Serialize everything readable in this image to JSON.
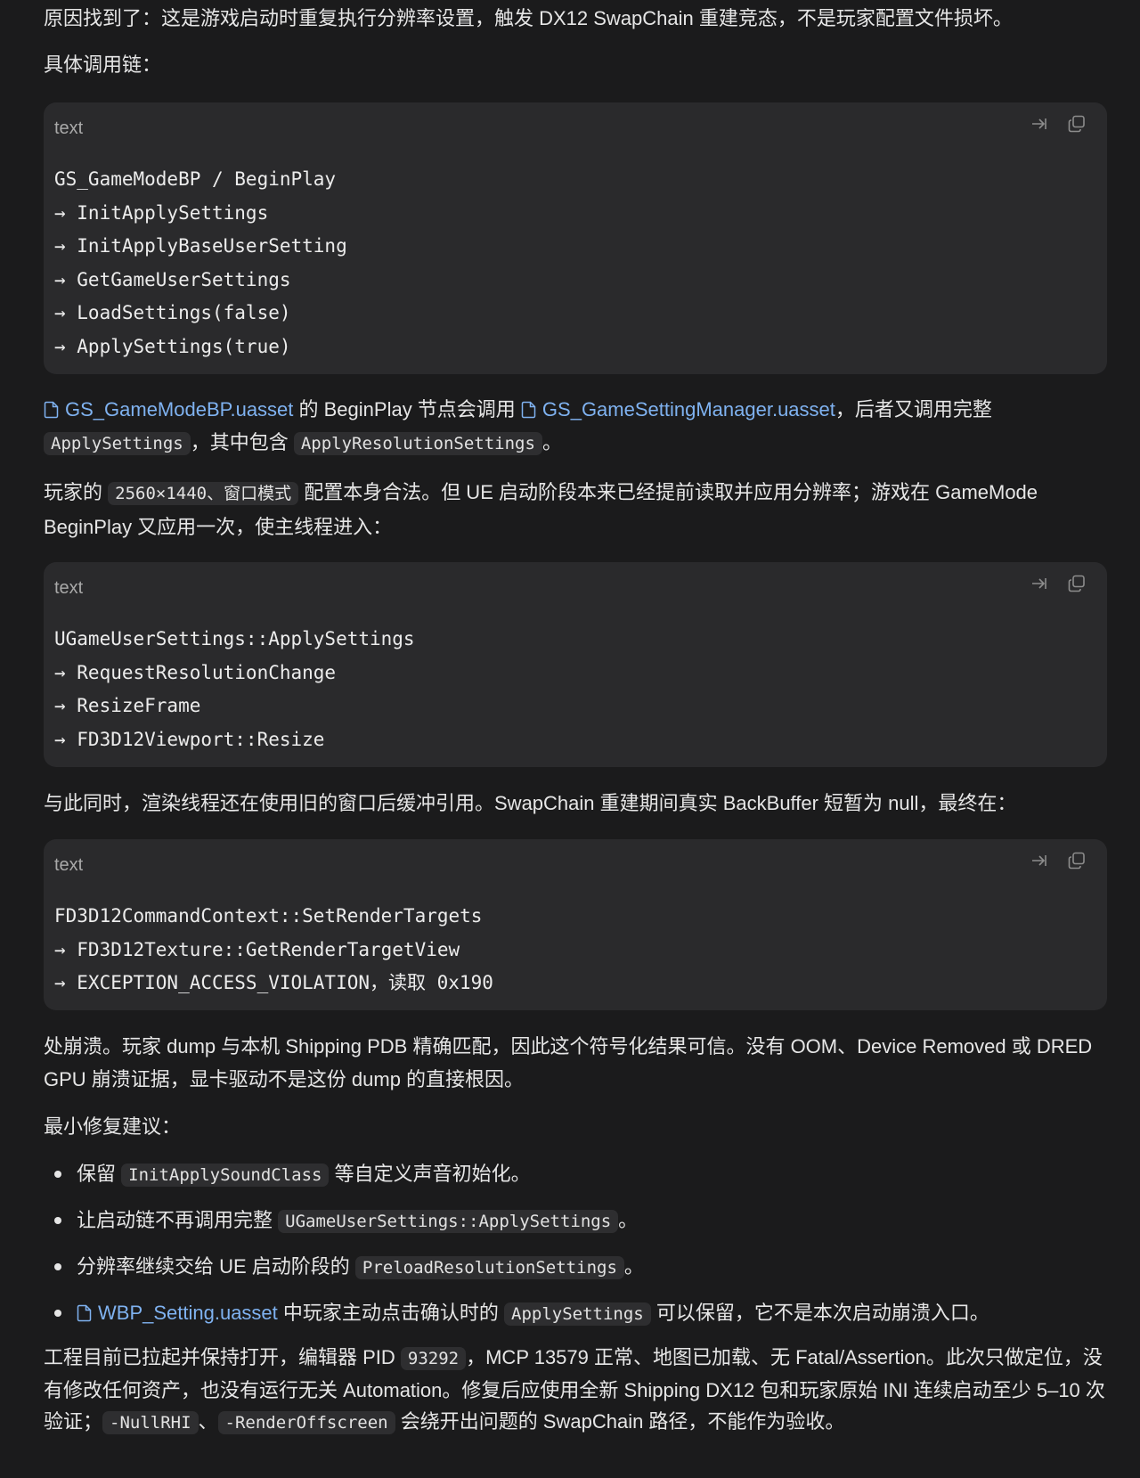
{
  "intro": "原因找到了：这是游戏启动时重复执行分辨率设置，触发 DX12 SwapChain 重建竞态，不是玩家配置文件损坏。",
  "chain_heading": "具体调用链：",
  "code_lang": "text",
  "code_blocks": [
    {
      "lines": [
        "GS_GameModeBP / BeginPlay",
        "→ InitApplySettings",
        "→ InitApplyBaseUserSetting",
        "→ GetGameUserSettings",
        "→ LoadSettings(false)",
        "→ ApplySettings(true)"
      ]
    },
    {
      "lines": [
        "UGameUserSettings::ApplySettings",
        "→ RequestResolutionChange",
        "→ ResizeFrame",
        "→ FD3D12Viewport::Resize"
      ]
    },
    {
      "lines": [
        "FD3D12CommandContext::SetRenderTargets",
        "→ FD3D12Texture::GetRenderTargetView",
        "→ EXCEPTION_ACCESS_VIOLATION，读取 0x190"
      ]
    }
  ],
  "para2": {
    "file1": "GS_GameModeBP.uasset",
    "t1": " 的 BeginPlay 节点会调用 ",
    "file2": "GS_GameSettingManager.uasset",
    "t2": "，后者又调用完整",
    "code1": "ApplySettings",
    "t3": "，其中包含 ",
    "code2": "ApplyResolutionSettings",
    "t4": "。"
  },
  "para3": {
    "t1": "玩家的 ",
    "code1": "2560×1440、窗口模式",
    "t2": " 配置本身合法。但 UE 启动阶段本来已经提前读取并应用分辨率；游戏在 GameMode BeginPlay 又应用一次，使主线程进入："
  },
  "para4": "与此同时，渲染线程还在使用旧的窗口后缓冲引用。SwapChain 重建期间真实 BackBuffer 短暂为 null，最终在：",
  "para5": "处崩溃。玩家 dump 与本机 Shipping PDB 精确匹配，因此这个符号化结果可信。没有 OOM、Device Removed 或 DRED GPU 崩溃证据，显卡驱动不是这份 dump 的直接根因。",
  "fix_heading": "最小修复建议：",
  "bullets": [
    {
      "pre": "保留 ",
      "code": "InitApplySoundClass",
      "post": " 等自定义声音初始化。"
    },
    {
      "pre": "让启动链不再调用完整 ",
      "code": "UGameUserSettings::ApplySettings",
      "post": "。"
    },
    {
      "pre": "分辨率继续交给 UE 启动阶段的 ",
      "code": "PreloadResolutionSettings",
      "post": "。"
    },
    {
      "file": "WBP_Setting.uasset",
      "pre": " 中玩家主动点击确认时的 ",
      "code": "ApplySettings",
      "post": " 可以保留，它不是本次启动崩溃入口。"
    }
  ],
  "para6": {
    "t1": "工程目前已拉起并保持打开，编辑器 PID ",
    "code1": "93292",
    "t2": "，MCP 13579 正常、地图已加载、无 Fatal/Assertion。此次只做定位，没有修改任何资产，也没有运行无关 Automation。修复后应使用全新 Shipping DX12 包和玩家原始 INI 连续启动至少 5–10 次验证；",
    "code2": "-NullRHI",
    "t3": "、",
    "code3": "-RenderOffscreen",
    "t4": " 会绕开出问题的 SwapChain 路径，不能作为验收。"
  },
  "colors": {
    "background": "#1b1b1c",
    "code_bg": "#2a2a2c",
    "inline_code_bg": "#2e2e30",
    "link": "#7fb2f0"
  },
  "icons": [
    "file-icon",
    "wrap-icon",
    "copy-icon"
  ]
}
